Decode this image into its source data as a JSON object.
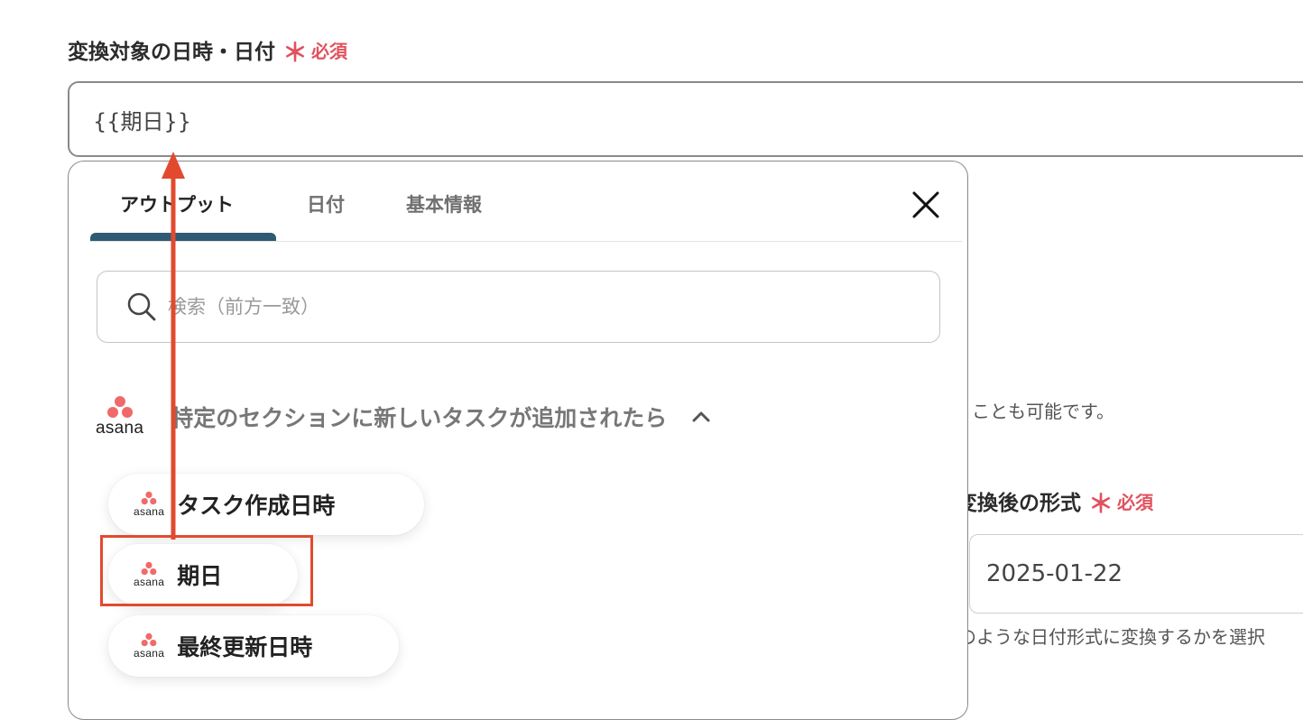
{
  "field": {
    "label": "変換対象の日時・日付",
    "required_star": "＊",
    "required_text": "必須",
    "value": "{{期日}}"
  },
  "background": {
    "hint_text": "ことも可能です。",
    "format_label": "変換後の形式",
    "format_required_star": "＊",
    "format_required_text": "必須",
    "format_value": "2025-01-22",
    "format_hint": "のような日付形式に変換するかを選択"
  },
  "panel": {
    "tabs": [
      {
        "label": "アウトプット",
        "active": true
      },
      {
        "label": "日付",
        "active": false
      },
      {
        "label": "基本情報",
        "active": false
      }
    ],
    "search_placeholder": "検索（前方一致）",
    "section": {
      "logo_text": "asana",
      "title": "特定のセクションに新しいタスクが追加されたら"
    },
    "items": [
      {
        "logo_text": "asana",
        "label": "タスク作成日時"
      },
      {
        "logo_text": "asana",
        "label": "期日"
      },
      {
        "logo_text": "asana",
        "label": "最終更新日時"
      }
    ]
  },
  "colors": {
    "accent_tab": "#2f5a73",
    "required": "#e0525e",
    "annotation": "#e24a2f",
    "asana_dots": "#f06a6a"
  }
}
